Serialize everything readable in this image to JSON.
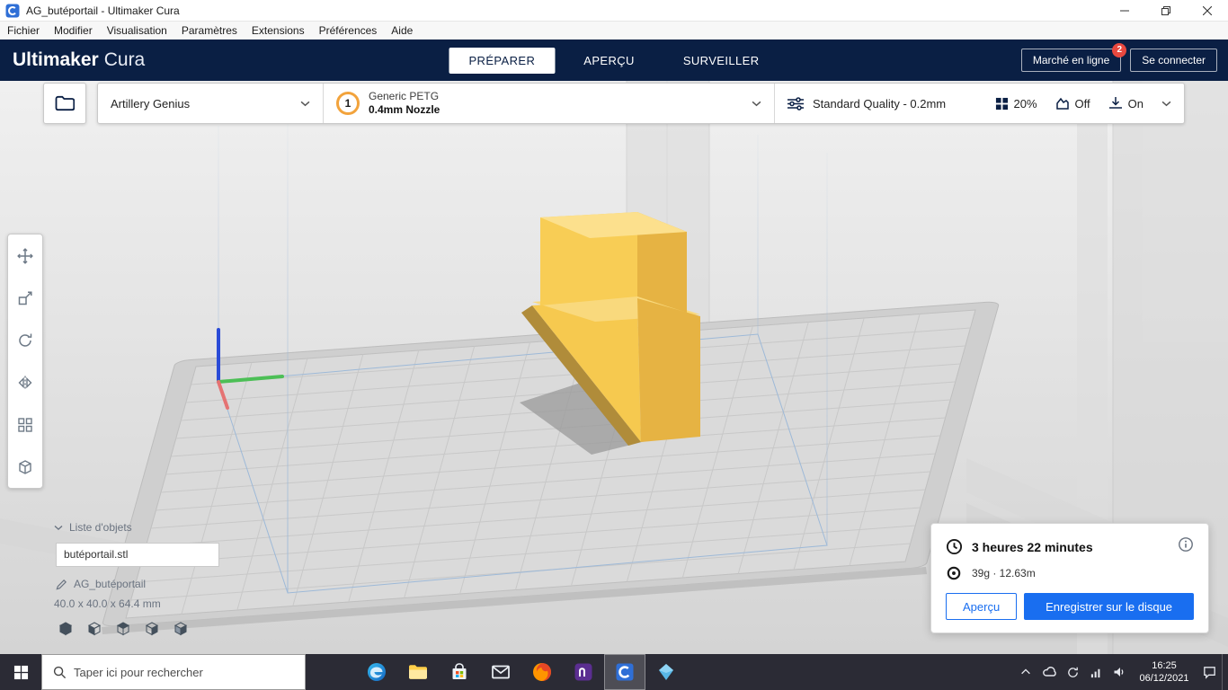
{
  "window": {
    "title": "AG_butéportail - Ultimaker Cura"
  },
  "menubar": {
    "items": [
      "Fichier",
      "Modifier",
      "Visualisation",
      "Paramètres",
      "Extensions",
      "Préférences",
      "Aide"
    ]
  },
  "header": {
    "brand_bold": "Ultimaker",
    "brand_light": "Cura",
    "tab_prepare": "PRÉPARER",
    "tab_preview": "APERÇU",
    "tab_monitor": "SURVEILLER",
    "marketplace_label": "Marché en ligne",
    "marketplace_badge": "2",
    "sign_in_label": "Se connecter"
  },
  "configbar": {
    "printer_name": "Artillery Genius",
    "extruder_number": "1",
    "material_name": "Generic PETG",
    "nozzle_size": "0.4mm Nozzle",
    "profile_label": "Standard Quality - 0.2mm",
    "infill_value": "20%",
    "support_value": "Off",
    "adhesion_value": "On"
  },
  "object_list": {
    "title": "Liste d'objets",
    "file_name": "butéportail.stl",
    "model_name": "AG_butéportail",
    "dimensions": "40.0 x 40.0 x 64.4 mm"
  },
  "print_summary": {
    "duration": "3 heures 22 minutes",
    "material": "39g · 12.63m",
    "preview_label": "Aperçu",
    "save_label": "Enregistrer sur le disque"
  },
  "taskbar": {
    "search_placeholder": "Taper ici pour rechercher",
    "clock_time": "16:25",
    "clock_date": "06/12/2021"
  },
  "colors": {
    "accent_blue": "#196ef0",
    "header_navy": "#0a1f44",
    "model_yellow": "#f8cd55",
    "badge_red": "#e8483f"
  }
}
